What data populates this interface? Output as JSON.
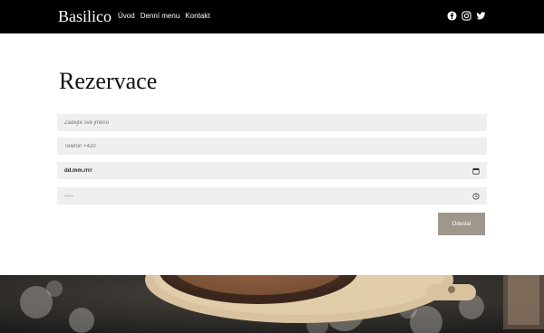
{
  "header": {
    "brand": "Basilico",
    "nav": [
      "Úvod",
      "Denní menu",
      "Kontakt"
    ],
    "social": [
      "facebook-icon",
      "instagram-icon",
      "twitter-icon"
    ]
  },
  "form": {
    "title": "Rezervace",
    "name_placeholder": "Zadejte své jméno",
    "phone_placeholder": "Telefon +420",
    "date_value": "dd.mm.rrrr",
    "time_value": "--:--",
    "submit_label": "Odeslat"
  },
  "colors": {
    "header_bg": "#000000",
    "field_bg": "#efefef",
    "button_bg": "#a0978c"
  }
}
